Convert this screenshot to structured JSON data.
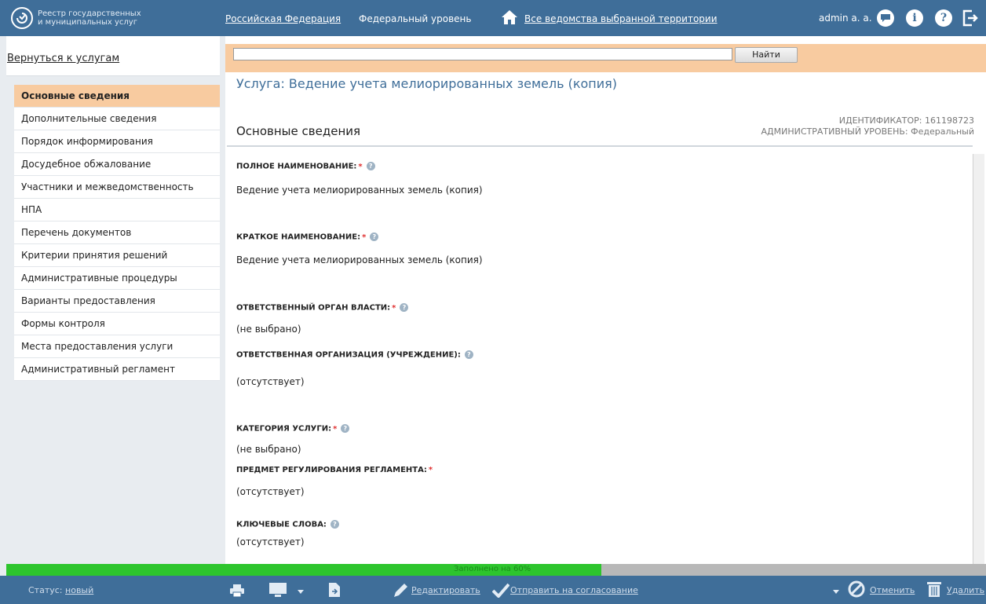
{
  "header": {
    "logo_text": "Реестр государственных и муниципальных услуг",
    "region_link": "Российская Федерация",
    "level_link": "Федеральный уровень",
    "agencies_link": "Все ведомства выбранной территории",
    "user": "admin a. a.",
    "icons": [
      "chat-icon",
      "info-icon",
      "help-icon",
      "logout-icon"
    ]
  },
  "sidebar": {
    "back_label": "Вернуться к услугам",
    "items": [
      {
        "label": "Основные сведения",
        "active": true
      },
      {
        "label": "Дополнительные сведения"
      },
      {
        "label": "Порядок информирования"
      },
      {
        "label": "Досудебное обжалование"
      },
      {
        "label": "Участники и межведомственность"
      },
      {
        "label": "НПА"
      },
      {
        "label": "Перечень документов"
      },
      {
        "label": "Критерии принятия решений"
      },
      {
        "label": "Административные процедуры"
      },
      {
        "label": "Варианты предоставления"
      },
      {
        "label": "Формы контроля"
      },
      {
        "label": "Места предоставления услуги"
      },
      {
        "label": "Административный регламент"
      }
    ]
  },
  "search": {
    "value": "",
    "button_label": "Найти"
  },
  "main": {
    "title": "Услуга: Ведение учета мелиорированных земель (копия)",
    "section_title": "Основные сведения",
    "identifier": "ИДЕНТИФИКАТОР: 161198723",
    "admin_level": "АДМИНИСТРАТИВНЫЙ УРОВЕНЬ: Федеральный",
    "fields": [
      {
        "label": "ПОЛНОЕ НАИМЕНОВАНИЕ:",
        "required": true,
        "help": true,
        "value": "Ведение учета мелиорированных земель (копия)"
      },
      {
        "label": "КРАТКОЕ НАИМЕНОВАНИЕ:",
        "required": true,
        "help": true,
        "value": "Ведение учета мелиорированных земель (копия)"
      },
      {
        "label": "ОТВЕТСТВЕННЫЙ ОРГАН ВЛАСТИ:",
        "required": true,
        "help": true,
        "value": "(не выбрано)"
      },
      {
        "label": "ОТВЕТСТВЕННАЯ ОРГАНИЗАЦИЯ (УЧРЕЖДЕНИЕ):",
        "required": false,
        "help": true,
        "value": "(отсутствует)"
      },
      {
        "label": "КАТЕГОРИЯ УСЛУГИ:",
        "required": true,
        "help": true,
        "value": "(не выбрано)"
      },
      {
        "label": "ПРЕДМЕТ РЕГУЛИРОВАНИЯ РЕГЛАМЕНТА:",
        "required": true,
        "help": false,
        "value": "(отсутствует)"
      },
      {
        "label": "КЛЮЧЕВЫЕ СЛОВА:",
        "required": false,
        "help": true,
        "value": "(отсутствует)"
      }
    ],
    "required_mark": "*",
    "help_mark": "?"
  },
  "progress": {
    "fraction": 0.607,
    "text": "Заполнено на 60%"
  },
  "footer": {
    "status_label": "Статус:",
    "status_value": "новый",
    "edit_label": "Редактировать",
    "send_label": "Отправить на согласование",
    "cancel_label": "Отменить",
    "delete_label": "Удалить"
  }
}
